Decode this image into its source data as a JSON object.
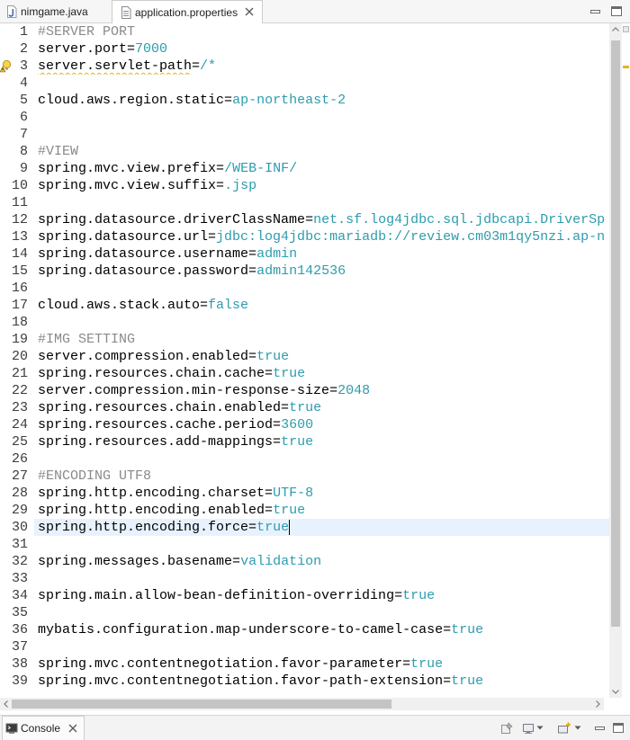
{
  "tabs": [
    {
      "label": "nimgame.java",
      "icon": "java-file-icon",
      "active": false
    },
    {
      "label": "application.properties",
      "icon": "properties-file-icon",
      "active": true
    }
  ],
  "editor": {
    "separator": "=",
    "lines": [
      {
        "n": 1,
        "comment": "#SERVER PORT"
      },
      {
        "n": 2,
        "key": "server.port",
        "value": "7000"
      },
      {
        "n": 3,
        "key": "server.servlet-path",
        "value": "/*",
        "warning": true
      },
      {
        "n": 4
      },
      {
        "n": 5,
        "key": "cloud.aws.region.static",
        "value": "ap-northeast-2"
      },
      {
        "n": 6
      },
      {
        "n": 7
      },
      {
        "n": 8,
        "comment": "#VIEW"
      },
      {
        "n": 9,
        "key": "spring.mvc.view.prefix",
        "value": "/WEB-INF/"
      },
      {
        "n": 10,
        "key": "spring.mvc.view.suffix",
        "value": ".jsp"
      },
      {
        "n": 11
      },
      {
        "n": 12,
        "key": "spring.datasource.driverClassName",
        "value": "net.sf.log4jdbc.sql.jdbcapi.DriverSp"
      },
      {
        "n": 13,
        "key": "spring.datasource.url",
        "value": "jdbc:log4jdbc:mariadb://review.cm03m1qy5nzi.ap-n"
      },
      {
        "n": 14,
        "key": "spring.datasource.username",
        "value": "admin"
      },
      {
        "n": 15,
        "key": "spring.datasource.password",
        "value": "admin142536"
      },
      {
        "n": 16
      },
      {
        "n": 17,
        "key": "cloud.aws.stack.auto",
        "value": "false"
      },
      {
        "n": 18
      },
      {
        "n": 19,
        "comment": "#IMG SETTING"
      },
      {
        "n": 20,
        "key": "server.compression.enabled",
        "value": "true"
      },
      {
        "n": 21,
        "key": "spring.resources.chain.cache",
        "value": "true"
      },
      {
        "n": 22,
        "key": "server.compression.min-response-size",
        "value": "2048"
      },
      {
        "n": 23,
        "key": "spring.resources.chain.enabled",
        "value": "true"
      },
      {
        "n": 24,
        "key": "spring.resources.cache.period",
        "value": "3600"
      },
      {
        "n": 25,
        "key": "spring.resources.add-mappings",
        "value": "true"
      },
      {
        "n": 26
      },
      {
        "n": 27,
        "comment": "#ENCODING UTF8"
      },
      {
        "n": 28,
        "key": "spring.http.encoding.charset",
        "value": "UTF-8"
      },
      {
        "n": 29,
        "key": "spring.http.encoding.enabled",
        "value": "true"
      },
      {
        "n": 30,
        "key": "spring.http.encoding.force",
        "value": "true",
        "current": true
      },
      {
        "n": 31
      },
      {
        "n": 32,
        "key": "spring.messages.basename",
        "value": "validation"
      },
      {
        "n": 33
      },
      {
        "n": 34,
        "key": "spring.main.allow-bean-definition-overriding",
        "value": "true"
      },
      {
        "n": 35
      },
      {
        "n": 36,
        "key": "mybatis.configuration.map-underscore-to-camel-case",
        "value": "true"
      },
      {
        "n": 37
      },
      {
        "n": 38,
        "key": "spring.mvc.contentnegotiation.favor-parameter",
        "value": "true"
      },
      {
        "n": 39,
        "key": "spring.mvc.contentnegotiation.favor-path-extension",
        "value": "true"
      }
    ]
  },
  "console": {
    "tab_label": "Console",
    "icon": "console-icon",
    "toolbar_icons": [
      "pin-console-icon",
      "display-console-icon",
      "open-console-icon",
      "minimize-icon",
      "maximize-icon"
    ]
  },
  "colors": {
    "key": "#000000",
    "value": "#2d9cae",
    "comment": "#8a8a8a",
    "current_line": "#e8f2fe",
    "warning": "#e0b420",
    "line_number": "#3c3c3c"
  }
}
